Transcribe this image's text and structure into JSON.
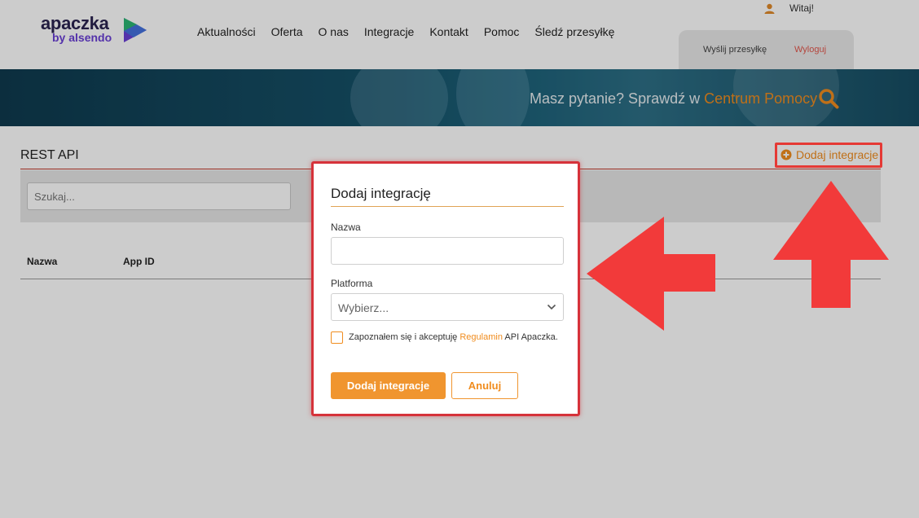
{
  "header": {
    "logo": {
      "main": "apaczka",
      "sub": "by alsendo"
    },
    "nav": [
      "Aktualności",
      "Oferta",
      "O nas",
      "Integracje",
      "Kontakt",
      "Pomoc",
      "Śledź przesyłkę"
    ],
    "welcome": "Witaj!",
    "account": {
      "send": "Wyślij przesyłkę",
      "logout": "Wyloguj"
    }
  },
  "banner": {
    "question": "Masz pytanie? Sprawdź w ",
    "link": "Centrum Pomocy"
  },
  "main": {
    "title": "REST API",
    "add_link": "Dodaj integracje",
    "search_placeholder": "Szukaj...",
    "table_headers": [
      "Nazwa",
      "App ID"
    ]
  },
  "modal": {
    "title": "Dodaj integrację",
    "name_label": "Nazwa",
    "name_value": "",
    "platform_label": "Platforma",
    "platform_value": "Wybierz...",
    "terms_prefix": "Zapoznałem się i akceptuję ",
    "terms_link": "Regulamin",
    "terms_suffix": " API Apaczka.",
    "terms_checked": false,
    "submit_label": "Dodaj integracje",
    "cancel_label": "Anuluj"
  },
  "colors": {
    "accent": "#f08c1e",
    "highlight": "#e53935",
    "banner": "#155067",
    "logo_text": "#2b2450"
  },
  "icons": [
    "user-icon",
    "search-icon",
    "plus-circle-icon",
    "chevron-down-icon",
    "logo-mark-icon",
    "arrow-left-icon",
    "arrow-up-icon"
  ]
}
